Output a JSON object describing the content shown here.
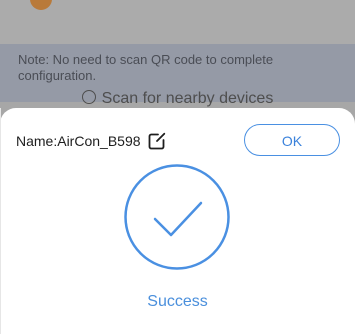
{
  "background": {
    "note_text": "Note: No need to scan QR code to complete configuration.",
    "scan_label": "Scan for nearby devices"
  },
  "sheet": {
    "name_prefix": "Name: ",
    "device_name": "AirCon_B598",
    "ok_label": "OK",
    "status_label": "Success",
    "accent_color": "#4a90e2"
  },
  "icons": {
    "edit": "edit-icon",
    "success": "success-check-icon",
    "scan": "scan-icon"
  }
}
